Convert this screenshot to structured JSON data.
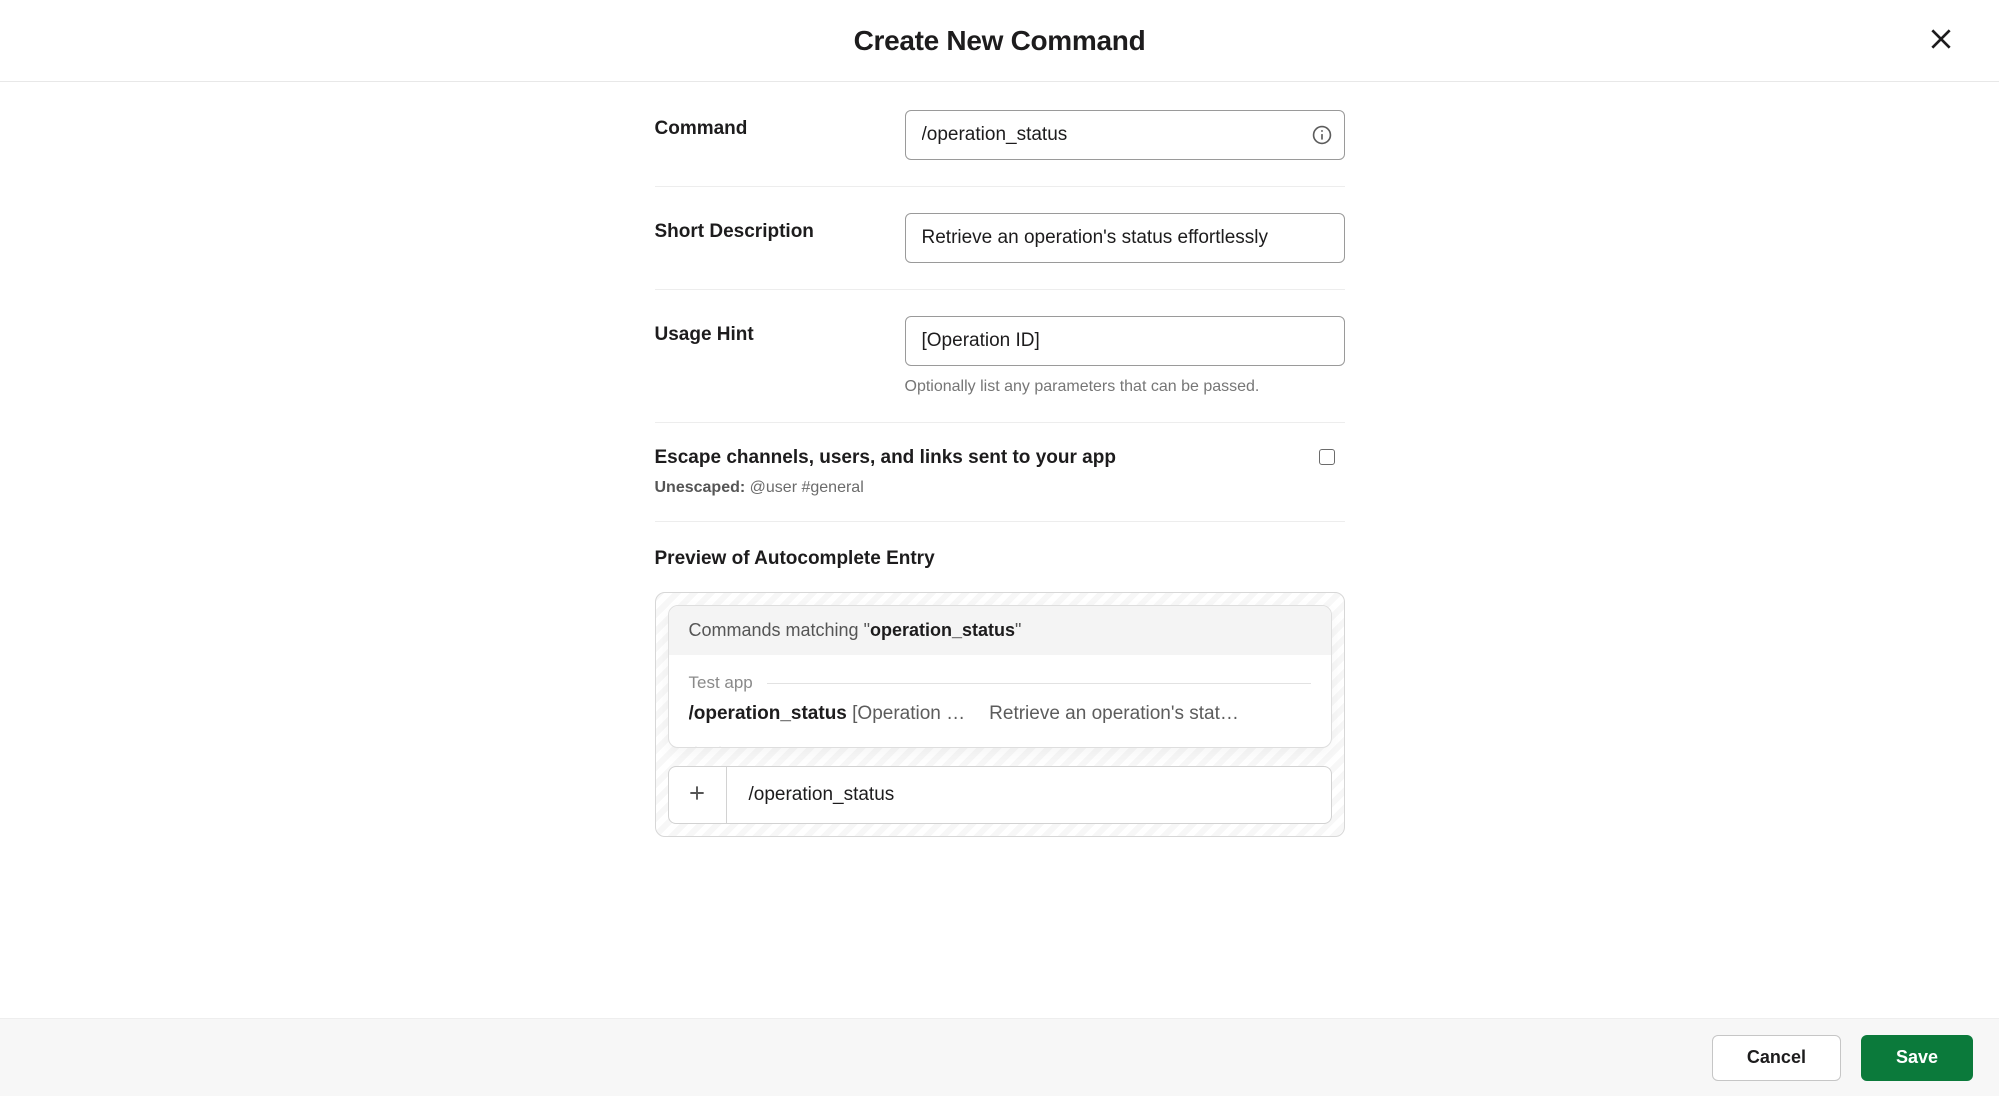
{
  "header": {
    "title": "Create New Command"
  },
  "fields": {
    "command": {
      "label": "Command",
      "value": "/operation_status"
    },
    "short_description": {
      "label": "Short Description",
      "value": "Retrieve an operation's status effortlessly"
    },
    "usage_hint": {
      "label": "Usage Hint",
      "value": "[Operation ID]",
      "helper": "Optionally list any parameters that can be passed."
    },
    "escape": {
      "label": "Escape channels, users, and links sent to your app",
      "sub_label": "Unescaped:",
      "sub_value": "@user #general",
      "checked": false
    }
  },
  "preview": {
    "title": "Preview of Autocomplete Entry",
    "matching_prefix": "Commands matching \"",
    "matching_query": "operation_status",
    "matching_suffix": "\"",
    "app_name": "Test app",
    "entry": {
      "command": "/operation_status",
      "hint": "[Operation …",
      "description": "Retrieve an operation's stat…"
    },
    "composer_text": "/operation_status"
  },
  "footer": {
    "cancel": "Cancel",
    "save": "Save"
  },
  "colors": {
    "primary": "#0b7a3b"
  }
}
